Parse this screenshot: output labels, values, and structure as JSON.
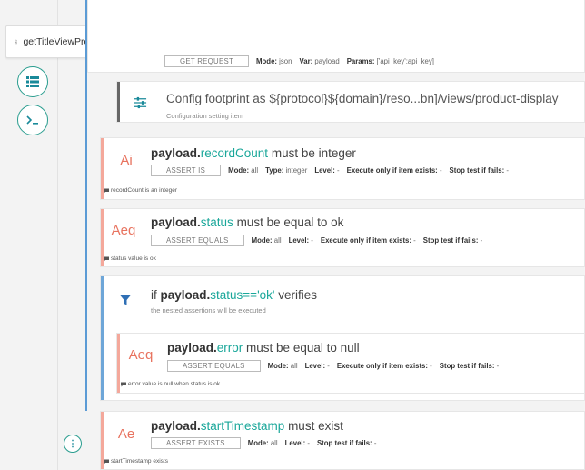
{
  "tab": {
    "label": "getTitleViewProductDisp..."
  },
  "toolbar": {
    "buttons": [
      "add",
      "edit",
      "move",
      "download",
      "upload",
      "check",
      "save",
      "delete",
      "export",
      "run"
    ]
  },
  "sidebar": {
    "buttons": [
      "list-view",
      "console"
    ]
  },
  "top_item": {
    "tag": "GET REQUEST",
    "mode_label": "Mode:",
    "mode_value": "json",
    "var_label": "Var:",
    "var_value": "payload",
    "params_label": "Params:",
    "params_value": "['api_key':api_key]"
  },
  "config_item": {
    "title": "Config footprint as ${protocol}${domain}/reso...bn]/views/product-display",
    "subtitle": "Configuration setting item"
  },
  "assert_is": {
    "icon": "Ai",
    "title_prefix": "payload.",
    "title_field": "recordCount",
    "title_rest": "must be integer",
    "tag": "ASSERT IS",
    "mode_label": "Mode:",
    "mode_value": "all",
    "type_label": "Type:",
    "type_value": "integer",
    "level_label": "Level:",
    "level_value": "-",
    "exec_label": "Execute only if item exists:",
    "exec_value": "-",
    "stop_label": "Stop test if fails:",
    "stop_value": "-",
    "comment": "recordCount is an integer"
  },
  "assert_eq_status": {
    "icon": "Aeq",
    "title_prefix": "payload.",
    "title_field": "status",
    "title_rest": "must be equal to ok",
    "tag": "ASSERT EQUALS",
    "mode_label": "Mode:",
    "mode_value": "all",
    "level_label": "Level:",
    "level_value": "-",
    "exec_label": "Execute only if item exists:",
    "exec_value": "-",
    "stop_label": "Stop test if fails:",
    "stop_value": "-",
    "comment": "status value is ok"
  },
  "if_item": {
    "title_pre": "if",
    "title_prefix": "payload.",
    "title_field": "status=='ok'",
    "title_rest": "verifies",
    "subtitle": "the nested assertions will be executed"
  },
  "assert_eq_error": {
    "icon": "Aeq",
    "title_prefix": "payload.",
    "title_field": "error",
    "title_rest": "must be equal to null",
    "tag": "ASSERT EQUALS",
    "mode_label": "Mode:",
    "mode_value": "all",
    "level_label": "Level:",
    "level_value": "-",
    "exec_label": "Execute only if item exists:",
    "exec_value": "-",
    "stop_label": "Stop test if fails:",
    "stop_value": "-",
    "comment": "error value is null when status is ok"
  },
  "assert_exists": {
    "icon": "Ae",
    "title_prefix": "payload.",
    "title_field": "startTimestamp",
    "title_rest": "must exist",
    "tag": "ASSERT EXISTS",
    "mode_label": "Mode:",
    "mode_value": "all",
    "level_label": "Level:",
    "level_value": "-",
    "stop_label": "Stop test if fails:",
    "stop_value": "-",
    "comment": "startTimestamp exists"
  },
  "colors": {
    "accent": "#1aa79a",
    "assert_stripe": "#f4a89b",
    "assert_icon": "#e8735f",
    "if_stripe": "#6ea6d8",
    "if_icon": "#2f6fb5",
    "tree_line": "#5b9bd5"
  }
}
